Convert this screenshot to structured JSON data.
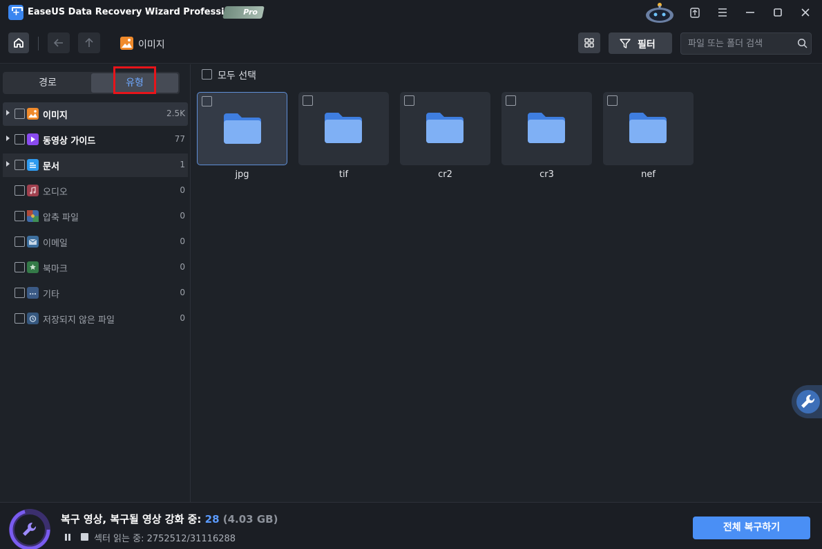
{
  "app": {
    "title": "EaseUS Data Recovery Wizard Professional",
    "badge": "Pro",
    "icons": [
      "app-logo-icon",
      "assistant-robot-icon",
      "export-icon",
      "menu-icon",
      "minimize-icon",
      "maximize-icon",
      "close-icon"
    ]
  },
  "toolbar": {
    "breadcrumb": "이미지",
    "filter_label": "필터",
    "search_placeholder": "파일 또는 폴더 검색"
  },
  "sidebar": {
    "tabs": {
      "path": "경로",
      "type": "유형"
    },
    "categories": [
      {
        "label": "이미지",
        "count": "2.5K",
        "icon": "image-icon",
        "color": "#f08a2b"
      },
      {
        "label": "동영상 가이드",
        "count": "77",
        "icon": "video-icon",
        "color": "#8a4af0"
      },
      {
        "label": "문서",
        "count": "1",
        "icon": "document-icon",
        "color": "#2f9bf0"
      },
      {
        "label": "오디오",
        "count": "0",
        "icon": "audio-icon",
        "color": "#c0485a"
      },
      {
        "label": "압축 파일",
        "count": "0",
        "icon": "archive-icon",
        "color": "#4a6fb0"
      },
      {
        "label": "이메일",
        "count": "0",
        "icon": "email-icon",
        "color": "#4a7fb0"
      },
      {
        "label": "북마크",
        "count": "0",
        "icon": "bookmark-icon",
        "color": "#3f8f55"
      },
      {
        "label": "기타",
        "count": "0",
        "icon": "other-folder-icon",
        "color": "#4a6a9a"
      },
      {
        "label": "저장되지 않은 파일",
        "count": "0",
        "icon": "unsaved-file-icon",
        "color": "#3f6a9a"
      }
    ]
  },
  "main": {
    "select_all": "모두 선택",
    "folders": [
      {
        "label": "jpg"
      },
      {
        "label": "tif"
      },
      {
        "label": "cr2"
      },
      {
        "label": "cr3"
      },
      {
        "label": "nef"
      }
    ]
  },
  "status": {
    "scan_text": "복구 영상, 복구될 영상 강화 중: ",
    "count": "28",
    "size": "(4.03 GB)",
    "sector_text": "섹터 읽는 중: 2752512/31116288",
    "recover_all": "전체 복구하기"
  }
}
